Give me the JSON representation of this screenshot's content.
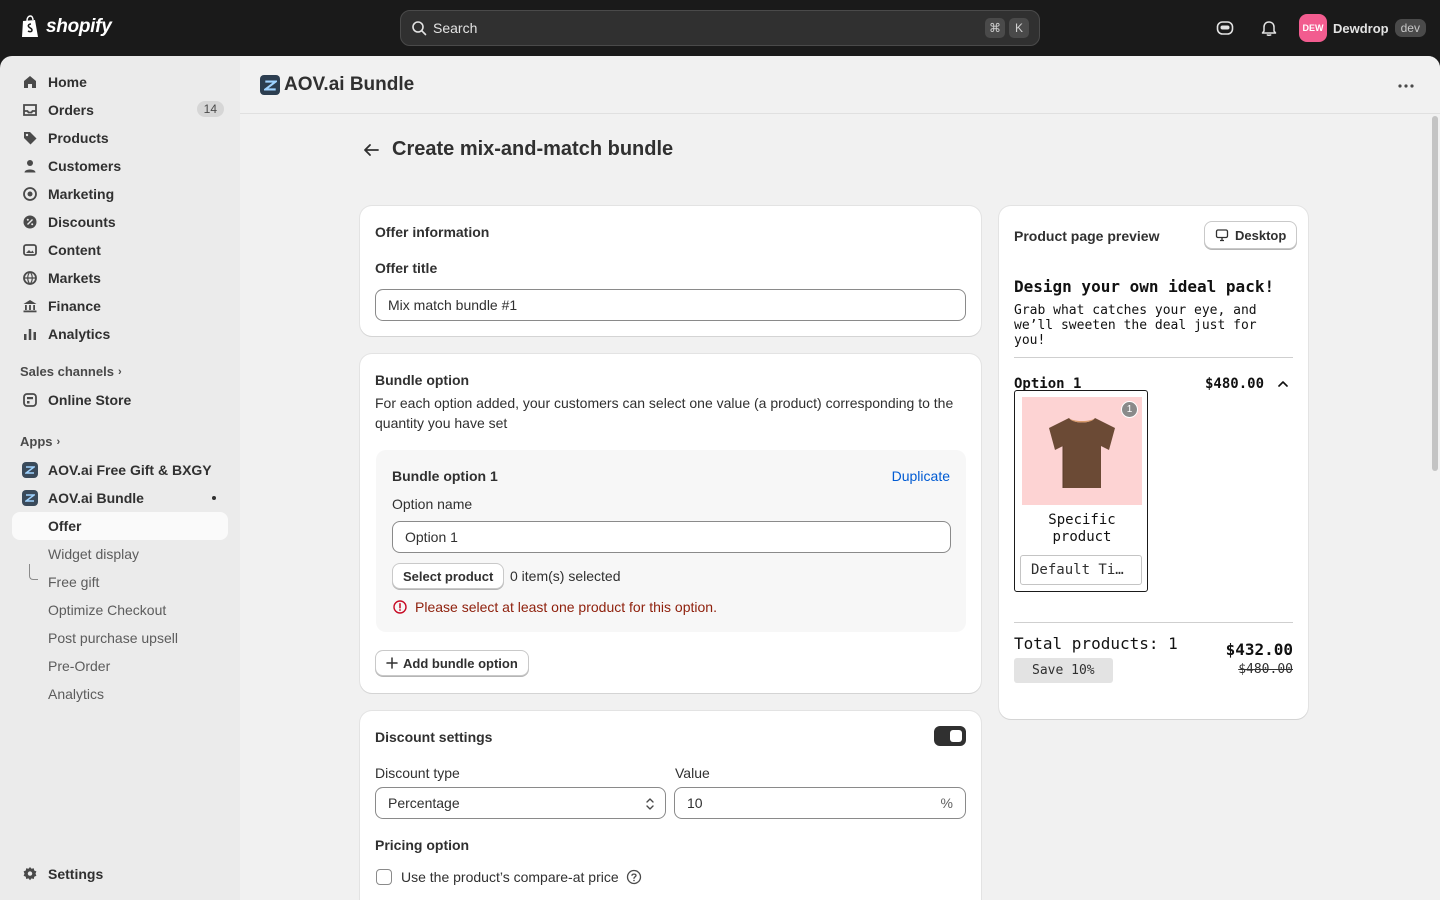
{
  "topbar": {
    "brand": "shopify",
    "search_placeholder": "Search",
    "shortcut_keys": [
      "⌘",
      "K"
    ],
    "account": {
      "initials": "DEW",
      "store": "Dewdrop",
      "badge": "dev"
    }
  },
  "sidebar": {
    "items": [
      {
        "label": "Home",
        "icon": "home-icon"
      },
      {
        "label": "Orders",
        "icon": "inbox-icon",
        "count": "14"
      },
      {
        "label": "Products",
        "icon": "tag-icon"
      },
      {
        "label": "Customers",
        "icon": "person-icon"
      },
      {
        "label": "Marketing",
        "icon": "target-icon"
      },
      {
        "label": "Discounts",
        "icon": "discount-icon"
      },
      {
        "label": "Content",
        "icon": "content-icon"
      },
      {
        "label": "Markets",
        "icon": "globe-icon"
      },
      {
        "label": "Finance",
        "icon": "bank-icon"
      },
      {
        "label": "Analytics",
        "icon": "bar-chart-icon"
      }
    ],
    "sales_channels_label": "Sales channels",
    "online_store": "Online Store",
    "apps_label": "Apps",
    "apps": [
      "AOV.ai Free Gift & BXGY",
      "AOV.ai Bundle"
    ],
    "sub_items": [
      "Offer",
      "Widget display",
      "Free gift",
      "Optimize Checkout",
      "Post purchase upsell",
      "Pre-Order",
      "Analytics"
    ],
    "settings": "Settings"
  },
  "app_header": {
    "title": "AOV.ai Bundle"
  },
  "page": {
    "title": "Create mix-and-match bundle"
  },
  "offer_info": {
    "heading": "Offer information",
    "title_label": "Offer title",
    "title_value": "Mix match bundle #1"
  },
  "bundle_option": {
    "heading": "Bundle option",
    "description": "For each option added, your customers can select one value (a product) corresponding to the quantity you have set",
    "option": {
      "heading": "Bundle option 1",
      "duplicate": "Duplicate",
      "name_label": "Option name",
      "name_value": "Option 1",
      "select_button": "Select product",
      "selected_text": "0 item(s) selected",
      "error": "Please select at least one product for this option."
    },
    "add_button": "Add bundle option"
  },
  "discount": {
    "heading": "Discount settings",
    "type_label": "Discount type",
    "type_value": "Percentage",
    "value_label": "Value",
    "value": "10",
    "suffix": "%",
    "pricing_heading": "Pricing option",
    "compare_at_label": "Use the product’s compare-at price",
    "enabled": true
  },
  "preview": {
    "heading": "Product page preview",
    "device_button": "Desktop",
    "title": "Design your own ideal pack!",
    "subtitle": "Grab what catches your eye, and we’ll sweeten the deal just for you!",
    "option_label": "Option 1",
    "option_price": "$480.00",
    "product_qty": "1",
    "product_name": "Specific product",
    "variant": "Default Ti…",
    "total_label": "Total products: 1",
    "save_label": "Save 10%",
    "total_price": "$432.00",
    "original_price": "$480.00"
  }
}
